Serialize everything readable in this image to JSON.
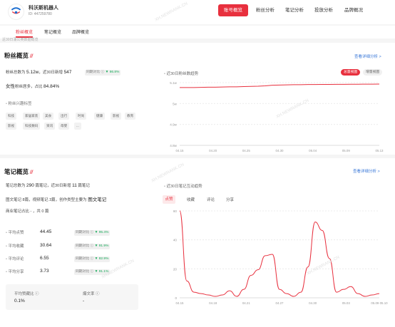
{
  "header": {
    "account_name": "科沃斯机器人",
    "account_id": "ID: 447259780",
    "nav": [
      "账号概览",
      "粉丝分析",
      "笔记分析",
      "投放分析",
      "品牌概况"
    ],
    "active_nav": 0,
    "watermark": "XH.NEWRANK.CN"
  },
  "subnav": {
    "tabs": [
      "粉丝概览",
      "笔记概览",
      "品牌概览"
    ],
    "active": 0
  },
  "notice": "近30日蒲公英数据概览",
  "fans": {
    "title": "粉丝概览",
    "more": "查看详细分析 >",
    "count_label": "粉丝总数为",
    "count_value": "5.12w",
    "recent_label": "，近30日新增",
    "recent_value": "547",
    "cmp_label": "同期对比 ⓘ",
    "cmp_value": "▼ 86.8%",
    "gender_big": "女性",
    "gender_rest": "粉丝居多，占比",
    "gender_pct": "84.84%",
    "interest_title": "粉丝兴趣标签",
    "tags": [
      "科技",
      "家居家装",
      "美食",
      "出行",
      "时尚",
      "健康",
      "影视",
      "教育",
      "影视",
      "科技数码",
      "资讯",
      "母婴",
      "..."
    ],
    "chart_title": "近30日粉丝数趋势",
    "toggle": [
      "总量视图",
      "增量视图"
    ]
  },
  "notes": {
    "title": "笔记概览",
    "more": "查看详细分析 >",
    "total_label": "笔记总数为",
    "total_value": "290",
    "total_unit": "篇笔记，近30日新增",
    "new_value": "11",
    "new_unit": "篇笔记",
    "detail": "图文笔记 8篇，视频笔记 3篇，创作类型主要为",
    "detail_big": "图文笔记",
    "commercial": "商业笔记占比 - ，共 0 篇",
    "metrics": [
      {
        "label": "平均点赞",
        "value": "44.45",
        "cmp": "同期对比 ⓘ",
        "delta": "▼ 95.4%"
      },
      {
        "label": "平均收藏",
        "value": "30.64",
        "cmp": "同期对比 ⓘ",
        "delta": "▼ 91.9%"
      },
      {
        "label": "平均评论",
        "value": "6.55",
        "cmp": "同期对比 ⓘ",
        "delta": "▼ 82.9%"
      },
      {
        "label": "平均分享",
        "value": "3.73",
        "cmp": "同期对比 ⓘ",
        "delta": "▼ 91.1%"
      }
    ],
    "box1_label": "平均赞藏比 ⓘ",
    "box1_value": "0.1%",
    "box2_label": "爆文率 ⓘ",
    "box2_value": "-",
    "chart_title": "近30日笔记互动趋势",
    "chart_tabs": [
      "点赞",
      "收藏",
      "评论",
      "分享"
    ],
    "active_chart_tab": 0
  },
  "chart_data": [
    {
      "type": "line",
      "title": "近30日粉丝数趋势",
      "x": [
        "04.15",
        "04.16",
        "04.17",
        "04.18",
        "04.19",
        "04.20",
        "04.21",
        "04.22",
        "04.23",
        "04.24",
        "04.25",
        "04.26",
        "04.27",
        "04.28",
        "04.29",
        "04.30",
        "05.01",
        "05.02",
        "05.03",
        "05.04",
        "05.05",
        "05.06",
        "05.07",
        "05.08",
        "05.09",
        "05.10",
        "05.11",
        "05.12",
        "05.13"
      ],
      "x_tick_labels": [
        "04.15",
        "04.20",
        "04.25",
        "04.30",
        "05.04",
        "05.09",
        "05.13"
      ],
      "y_tick_labels": [
        "5.1w",
        "5w",
        "4.9w",
        "4.8w"
      ],
      "ylim": [
        48000,
        51500
      ],
      "series": [
        {
          "values": [
            51020,
            51020,
            51020,
            51030,
            51040,
            51040,
            51050,
            51060,
            51060,
            51070,
            51080,
            51090,
            51110,
            51140,
            51150,
            51160,
            51170,
            51170,
            51180,
            51180,
            51185,
            51185,
            51190,
            51190,
            51192,
            51194,
            51196,
            51198,
            51200
          ]
        }
      ],
      "color": "#e8303e",
      "grid": true
    },
    {
      "type": "line",
      "title": "近30日笔记互动趋势",
      "x": [
        "04.15",
        "04.16",
        "04.17",
        "04.18",
        "04.19",
        "04.20",
        "04.21",
        "04.22",
        "04.23",
        "04.24",
        "04.25",
        "04.26",
        "04.27",
        "04.28",
        "04.29",
        "04.30",
        "05.01",
        "05.02",
        "05.03",
        "05.04",
        "05.05",
        "05.06",
        "05.07",
        "05.08",
        "05.09",
        "05.10",
        "05.11",
        "05.12",
        "05.13"
      ],
      "x_tick_labels": [
        "04.15",
        "04.18",
        "04.21",
        "04.27",
        "04.30",
        "05.03",
        "05.09 05.10"
      ],
      "y_tick_labels": [
        "60",
        "40",
        "20",
        "0"
      ],
      "ylim": [
        0,
        65
      ],
      "series": [
        {
          "values": [
            62,
            12,
            4,
            3,
            2,
            1,
            2,
            5,
            1,
            6,
            16,
            20,
            30,
            31,
            6,
            3,
            1,
            4,
            22,
            54,
            48,
            28,
            4,
            6,
            8,
            3,
            1,
            2,
            3
          ]
        }
      ],
      "color": "#e8303e",
      "grid": true
    }
  ]
}
